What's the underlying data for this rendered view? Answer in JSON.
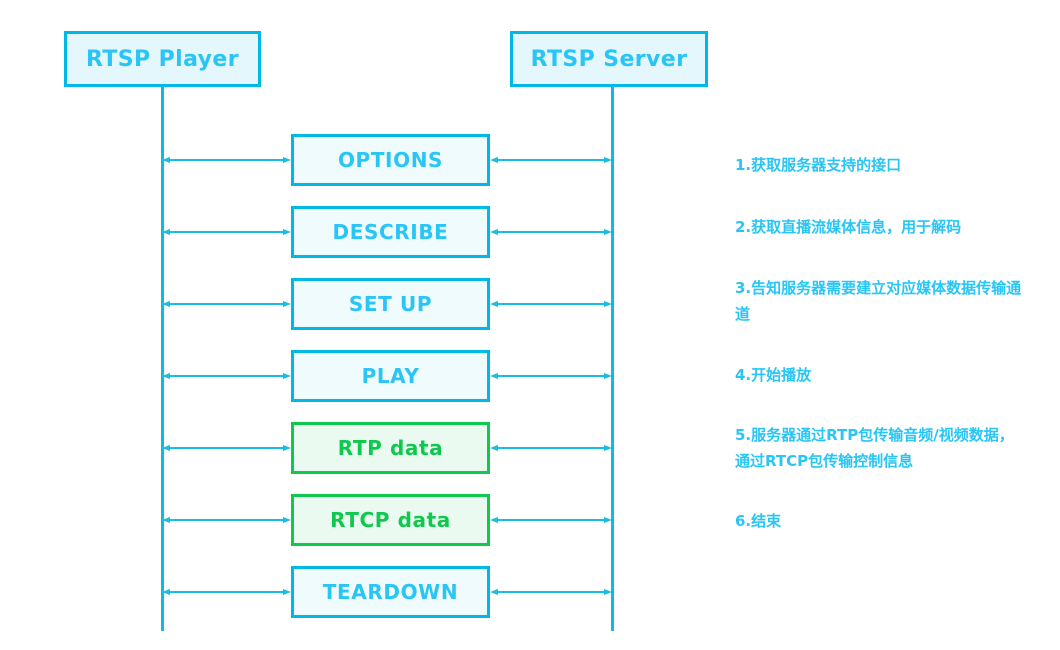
{
  "actors": [
    {
      "id": "player",
      "label": "RTSP Player"
    },
    {
      "id": "server",
      "label": "RTSP Server"
    }
  ],
  "messages": [
    {
      "label": "OPTIONS",
      "color": "cyan"
    },
    {
      "label": "DESCRIBE",
      "color": "cyan"
    },
    {
      "label": "SET UP",
      "color": "cyan"
    },
    {
      "label": "PLAY",
      "color": "cyan"
    },
    {
      "label": "RTP data",
      "color": "green"
    },
    {
      "label": "RTCP data",
      "color": "green"
    },
    {
      "label": "TEARDOWN",
      "color": "cyan"
    }
  ],
  "notes": [
    {
      "text": "1.获取服务器支持的接口"
    },
    {
      "text": "2.获取直播流媒体信息，用于解码"
    },
    {
      "text": "3.告知服务器需要建立对应媒体数据传输通道"
    },
    {
      "text": "4.开始播放"
    },
    {
      "text": "5.服务器通过RTP包传输音频/视频数据，通过RTCP包传输控制信息"
    },
    {
      "text": "6.结束"
    }
  ],
  "colors": {
    "cyan_border": "#00b8e6",
    "cyan_fill": "#f0fbfd",
    "cyan_text": "#29c5f6",
    "green_border": "#0ec94e",
    "green_fill": "#eafaf0",
    "green_text": "#0ec94e",
    "arrow": "#18bde4",
    "lifeline": "#0cbce0",
    "actor_fill": "#e4f7fc",
    "background": "#ffffff"
  }
}
